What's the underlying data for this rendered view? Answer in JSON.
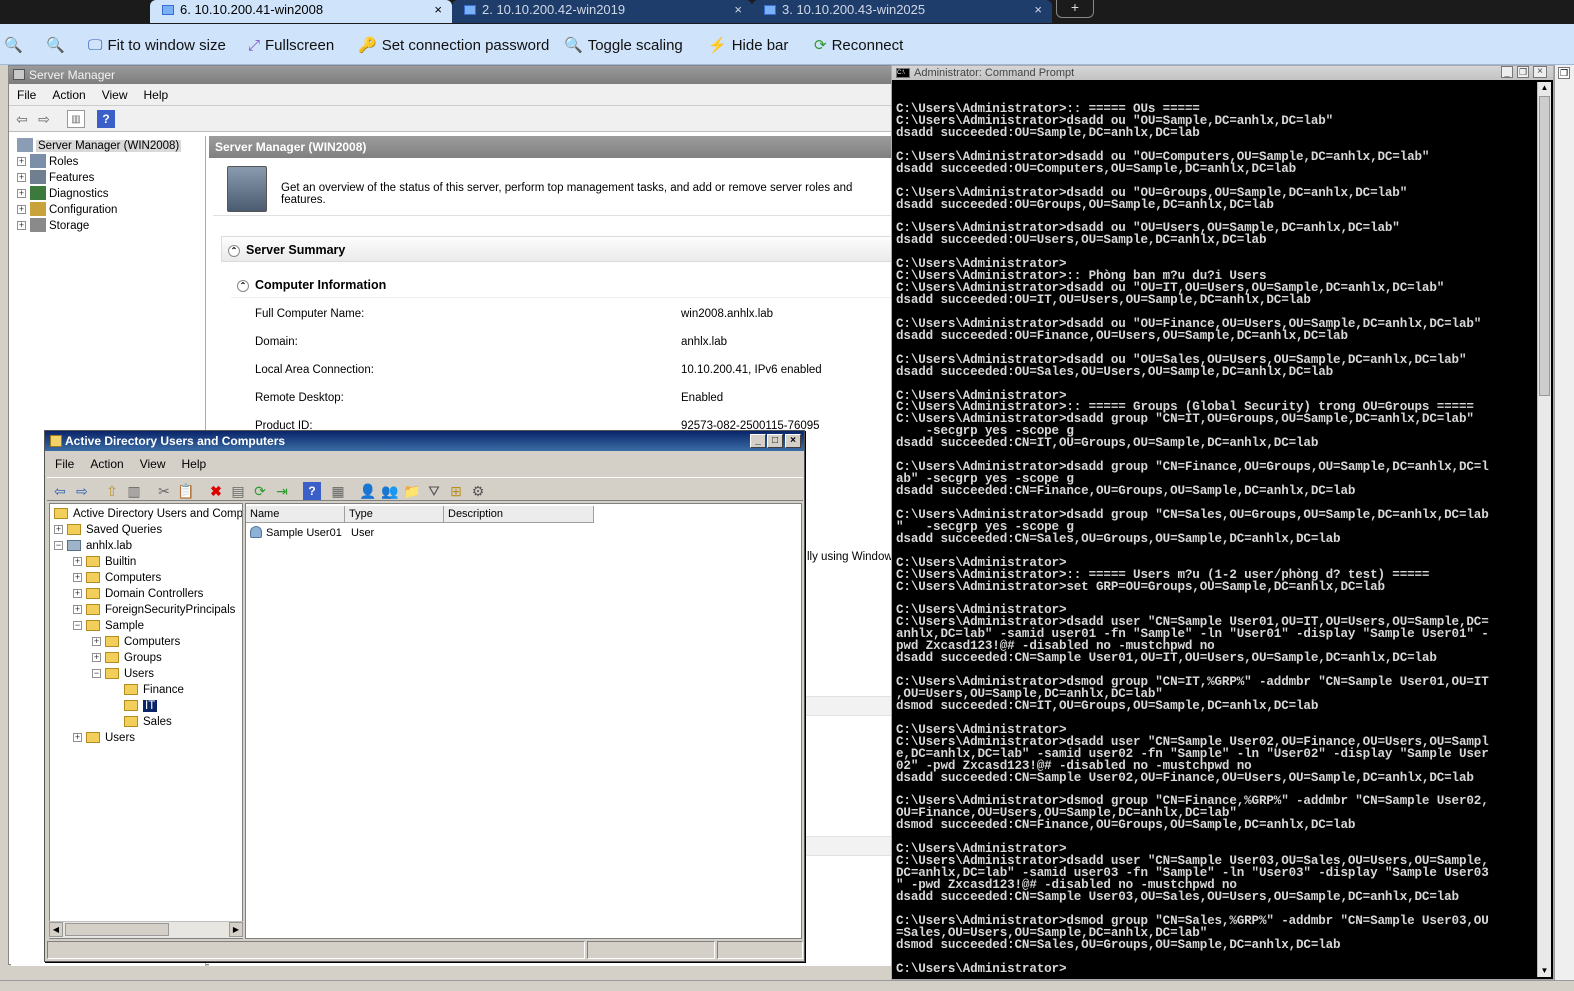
{
  "tabs": [
    {
      "label": "6. 10.10.200.41-win2008",
      "close": "×"
    },
    {
      "label": "2.  10.10.200.42-win2019",
      "close": "×"
    },
    {
      "label": "3.  10.10.200.43-win2025",
      "close": "×"
    }
  ],
  "new_tab": "+",
  "viewer_toolbar": {
    "fit": "Fit to window size",
    "fullscreen": "Fullscreen",
    "set_password": "Set connection password",
    "toggle_scaling": "Toggle scaling",
    "hide_bar": "Hide bar",
    "reconnect": "Reconnect"
  },
  "server_manager": {
    "title": "Server Manager",
    "menu": [
      "File",
      "Action",
      "View",
      "Help"
    ],
    "tree": {
      "root": "Server Manager (WIN2008)",
      "items": [
        "Roles",
        "Features",
        "Diagnostics",
        "Configuration",
        "Storage"
      ]
    },
    "header": "Server Manager (WIN2008)",
    "overview": "Get an overview of the status of this server, perform top management tasks, and add or remove server roles and features.",
    "summary": "Server Summary",
    "computer_info": "Computer Information",
    "info_rows": [
      {
        "label": "Full Computer Name:",
        "value": "win2008.anhlx.lab"
      },
      {
        "label": "Domain:",
        "value": "anhlx.lab"
      },
      {
        "label": "Local Area Connection:",
        "value": "10.10.200.41, IPv6 enabled"
      },
      {
        "label": "Remote Desktop:",
        "value": "Enabled"
      },
      {
        "label": "Product ID:",
        "value": "92573-082-2500115-76095"
      }
    ],
    "partial_text": "lly using Windows"
  },
  "aduc": {
    "title": "Active Directory Users and Computers",
    "menu": [
      "File",
      "Action",
      "View",
      "Help"
    ],
    "tree": {
      "root": "Active Directory Users and Comput",
      "saved": "Saved Queries",
      "domain": "anhlx.lab",
      "builtin": "Builtin",
      "computers": "Computers",
      "dcs": "Domain Controllers",
      "fsp": "ForeignSecurityPrincipals",
      "sample": "Sample",
      "s_computers": "Computers",
      "s_groups": "Groups",
      "s_users": "Users",
      "finance": "Finance",
      "it": "IT",
      "sales": "Sales",
      "users": "Users"
    },
    "columns": [
      "Name",
      "Type",
      "Description"
    ],
    "rows": [
      {
        "name": "Sample User01",
        "type": "User",
        "description": ""
      }
    ]
  },
  "cmd": {
    "title": "Administrator: Command Prompt",
    "lines": [
      "C:\\Users\\Administrator>:: ===== OUs =====",
      "C:\\Users\\Administrator>dsadd ou \"OU=Sample,DC=anhlx,DC=lab\"",
      "dsadd succeeded:OU=Sample,DC=anhlx,DC=lab",
      "",
      "C:\\Users\\Administrator>dsadd ou \"OU=Computers,OU=Sample,DC=anhlx,DC=lab\"",
      "dsadd succeeded:OU=Computers,OU=Sample,DC=anhlx,DC=lab",
      "",
      "C:\\Users\\Administrator>dsadd ou \"OU=Groups,OU=Sample,DC=anhlx,DC=lab\"",
      "dsadd succeeded:OU=Groups,OU=Sample,DC=anhlx,DC=lab",
      "",
      "C:\\Users\\Administrator>dsadd ou \"OU=Users,OU=Sample,DC=anhlx,DC=lab\"",
      "dsadd succeeded:OU=Users,OU=Sample,DC=anhlx,DC=lab",
      "",
      "C:\\Users\\Administrator>",
      "C:\\Users\\Administrator>:: Phòng ban m?u du?i Users",
      "C:\\Users\\Administrator>dsadd ou \"OU=IT,OU=Users,OU=Sample,DC=anhlx,DC=lab\"",
      "dsadd succeeded:OU=IT,OU=Users,OU=Sample,DC=anhlx,DC=lab",
      "",
      "C:\\Users\\Administrator>dsadd ou \"OU=Finance,OU=Users,OU=Sample,DC=anhlx,DC=lab\"",
      "dsadd succeeded:OU=Finance,OU=Users,OU=Sample,DC=anhlx,DC=lab",
      "",
      "C:\\Users\\Administrator>dsadd ou \"OU=Sales,OU=Users,OU=Sample,DC=anhlx,DC=lab\"",
      "dsadd succeeded:OU=Sales,OU=Users,OU=Sample,DC=anhlx,DC=lab",
      "",
      "C:\\Users\\Administrator>",
      "C:\\Users\\Administrator>:: ===== Groups (Global Security) trong OU=Groups =====",
      "C:\\Users\\Administrator>dsadd group \"CN=IT,OU=Groups,OU=Sample,DC=anhlx,DC=lab\"",
      "    -secgrp yes -scope g",
      "dsadd succeeded:CN=IT,OU=Groups,OU=Sample,DC=anhlx,DC=lab",
      "",
      "C:\\Users\\Administrator>dsadd group \"CN=Finance,OU=Groups,OU=Sample,DC=anhlx,DC=l",
      "ab\" -secgrp yes -scope g",
      "dsadd succeeded:CN=Finance,OU=Groups,OU=Sample,DC=anhlx,DC=lab",
      "",
      "C:\\Users\\Administrator>dsadd group \"CN=Sales,OU=Groups,OU=Sample,DC=anhlx,DC=lab",
      "\"   -secgrp yes -scope g",
      "dsadd succeeded:CN=Sales,OU=Groups,OU=Sample,DC=anhlx,DC=lab",
      "",
      "C:\\Users\\Administrator>",
      "C:\\Users\\Administrator>:: ===== Users m?u (1-2 user/phòng d? test) =====",
      "C:\\Users\\Administrator>set GRP=OU=Groups,OU=Sample,DC=anhlx,DC=lab",
      "",
      "C:\\Users\\Administrator>",
      "C:\\Users\\Administrator>dsadd user \"CN=Sample User01,OU=IT,OU=Users,OU=Sample,DC=",
      "anhlx,DC=lab\" -samid user01 -fn \"Sample\" -ln \"User01\" -display \"Sample User01\" -",
      "pwd Zxcasd123!@# -disabled no -mustchpwd no",
      "dsadd succeeded:CN=Sample User01,OU=IT,OU=Users,OU=Sample,DC=anhlx,DC=lab",
      "",
      "C:\\Users\\Administrator>dsmod group \"CN=IT,%GRP%\" -addmbr \"CN=Sample User01,OU=IT",
      ",OU=Users,OU=Sample,DC=anhlx,DC=lab\"",
      "dsmod succeeded:CN=IT,OU=Groups,OU=Sample,DC=anhlx,DC=lab",
      "",
      "C:\\Users\\Administrator>",
      "C:\\Users\\Administrator>dsadd user \"CN=Sample User02,OU=Finance,OU=Users,OU=Sampl",
      "e,DC=anhlx,DC=lab\" -samid user02 -fn \"Sample\" -ln \"User02\" -display \"Sample User",
      "02\" -pwd Zxcasd123!@# -disabled no -mustchpwd no",
      "dsadd succeeded:CN=Sample User02,OU=Finance,OU=Users,OU=Sample,DC=anhlx,DC=lab",
      "",
      "C:\\Users\\Administrator>dsmod group \"CN=Finance,%GRP%\" -addmbr \"CN=Sample User02,",
      "OU=Finance,OU=Users,OU=Sample,DC=anhlx,DC=lab\"",
      "dsmod succeeded:CN=Finance,OU=Groups,OU=Sample,DC=anhlx,DC=lab",
      "",
      "C:\\Users\\Administrator>",
      "C:\\Users\\Administrator>dsadd user \"CN=Sample User03,OU=Sales,OU=Users,OU=Sample,",
      "DC=anhlx,DC=lab\" -samid user03 -fn \"Sample\" -ln \"User03\" -display \"Sample User03",
      "\" -pwd Zxcasd123!@# -disabled no -mustchpwd no",
      "dsadd succeeded:CN=Sample User03,OU=Sales,OU=Users,OU=Sample,DC=anhlx,DC=lab",
      "",
      "C:\\Users\\Administrator>dsmod group \"CN=Sales,%GRP%\" -addmbr \"CN=Sample User03,OU",
      "=Sales,OU=Users,OU=Sample,DC=anhlx,DC=lab\"",
      "dsmod succeeded:CN=Sales,OU=Groups,OU=Sample,DC=anhlx,DC=lab",
      "",
      "C:\\Users\\Administrator>"
    ]
  },
  "colors": {
    "tab_active": "#cfe3fa",
    "tab_inactive": "#1f3d6b",
    "toolbar_bg": "#cfe3fa",
    "cmd_bg": "#000000",
    "aduc_title": "#0a246a"
  }
}
